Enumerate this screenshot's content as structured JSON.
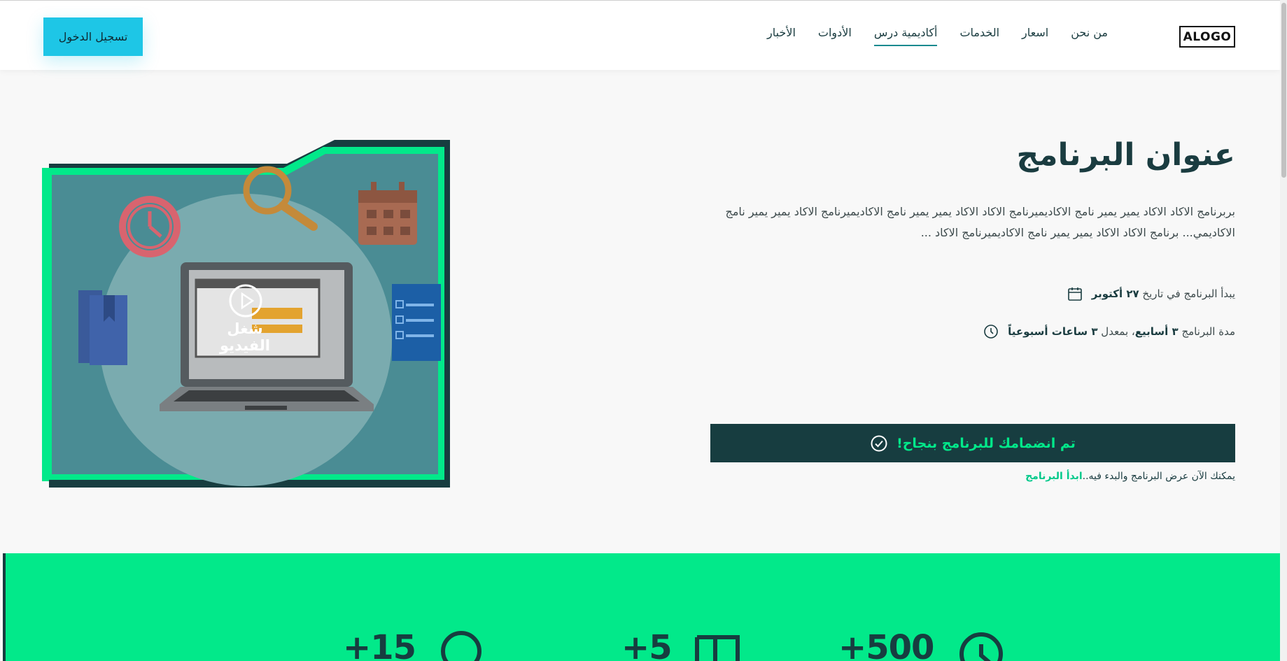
{
  "header": {
    "logo": "ALOGO",
    "nav": [
      "من نحن",
      "اسعار",
      "الخدمات",
      "أكاديمية درس",
      "الأدوات",
      "الأخبار"
    ],
    "active_nav": "أكاديمية درس",
    "login_label": "تسجيل الدخول"
  },
  "program": {
    "title": "عنوان البرنامج",
    "description": "بربرنامج الاكاد الاكاد يمير يمير نامج الاكاديميرنامج الاكاد الاكاد يمير يمير نامج الاكاديميرنامج الاكاد يمير يمير نامج الاكاديمي... برنامج الاكاد الاكاد يمير يمير نامج الاكاديميرنامج الاكاد ...",
    "start": {
      "prefix": "يبدأ البرنامج في تاريخ",
      "date": "٢٧ أكتوبر"
    },
    "duration": {
      "prefix": "مدة البرنامج",
      "weeks": "٣ أسابيع",
      "middle": "، بمعدل",
      "hours": "٣ ساعات أسبوعياً"
    },
    "joined_message": "تم انضمامك للبرنامج بنجاح!",
    "start_note": "يمكنك الآن عرض البرنامج والبدء فيه..",
    "start_link": "ابدأ البرنامج"
  },
  "video": {
    "play_label": "شغل الفيديو"
  },
  "stats": [
    {
      "value": "+15",
      "icon": "circle-icon"
    },
    {
      "value": "+5",
      "icon": "book-icon"
    },
    {
      "value": "+500",
      "icon": "clock-icon"
    }
  ],
  "colors": {
    "accent_green": "#02e98a",
    "dark_teal": "#173d40",
    "login_cyan": "#1ec6e6"
  }
}
